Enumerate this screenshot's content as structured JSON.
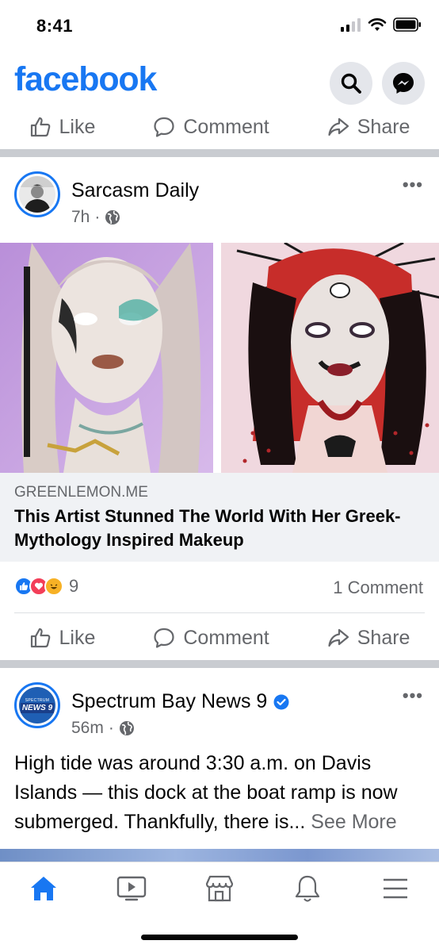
{
  "status": {
    "time": "8:41"
  },
  "header": {
    "logo": "facebook",
    "icons": [
      "search-icon",
      "messenger-icon"
    ]
  },
  "actions": {
    "like": "Like",
    "comment": "Comment",
    "share": "Share"
  },
  "post1": {
    "author": "Sarcasm Daily",
    "time": "7h",
    "separator": "·",
    "link": {
      "domain": "GREENLEMON.ME",
      "title": "This Artist Stunned The World With Her Greek-Mythology Inspired Makeup"
    },
    "reaction_count": "9",
    "comments": "1 Comment"
  },
  "post2": {
    "author": "Spectrum Bay News 9",
    "time": "56m",
    "separator": "·",
    "avatar_text": "NEWS 9",
    "avatar_small": "SPECTRUM",
    "text": "High tide was around 3:30 a.m. on Davis Islands — this dock at the boat ramp is now submerged. Thankfully, there is...",
    "see_more": "See More"
  },
  "tabbar": [
    "home-icon",
    "watch-icon",
    "marketplace-icon",
    "notifications-icon",
    "menu-icon"
  ],
  "colors": {
    "brand": "#1877f2",
    "secondary_text": "#65676b",
    "divider": "#c9ccd1"
  }
}
